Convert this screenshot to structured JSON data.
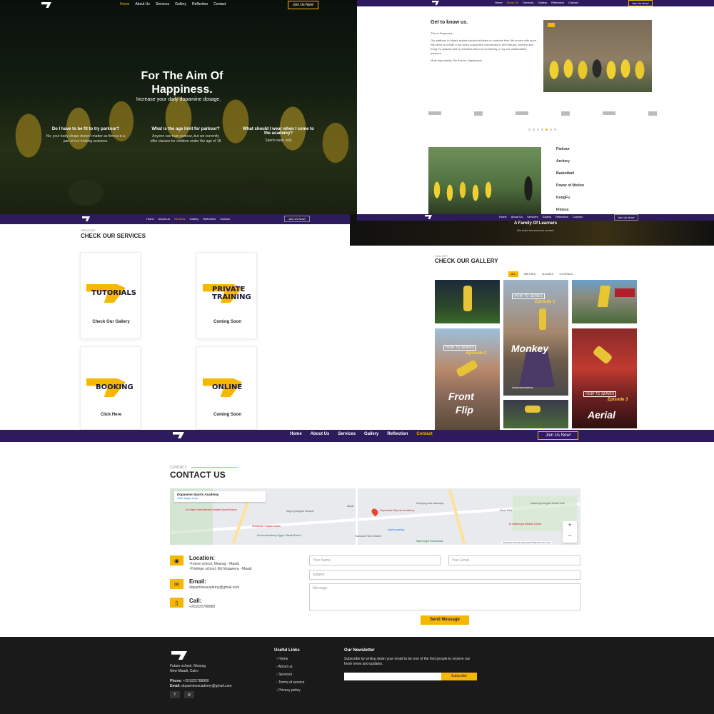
{
  "colors": {
    "primary": "#2d1b5e",
    "accent": "#f5b700",
    "dark": "#1a1a1a"
  },
  "nav": {
    "items": [
      "Home",
      "About Us",
      "Services",
      "Gallery",
      "Reflection",
      "Contact"
    ],
    "join": "Join Us Now!",
    "join_top": "Join Us Now!"
  },
  "hero": {
    "title1": "For The Aim Of",
    "title2": "Happiness.",
    "subtitle": "Increase your daily dopamine dosage.",
    "faqs": [
      {
        "q": "Do I have to be fit to try parkour?",
        "a": "No, your body shape doesn't matter as fitness is a part of our training sessions."
      },
      {
        "q": "What is the age limit for parkour?",
        "a": "Anyone can train parkour, but we currently offer classes for children under the age of 18"
      },
      {
        "q": "What should I wear when I come to the academy?",
        "a": "Sports wear only"
      }
    ]
  },
  "about": {
    "title": "Get to know us.",
    "p1": "This is Dopamine.",
    "p2": "Our platform in Maadi assists student athletes to combine their life moves with sport. We strive to create a fun and a supportive community in the Parkour, Archery and Kung Fu classes that is provided either by us directly, or by our collaborative partners.",
    "p3": "Most importantly, We Aim for Happiness!",
    "services": [
      "Parkour",
      "Archery",
      "Basketball",
      "Power of Motion",
      "KungFu",
      "Fitness"
    ]
  },
  "services_section": {
    "kicker": "SERVICES",
    "title": "CHECK OUR SERVICES",
    "cards": [
      {
        "title": "TUTORIALS",
        "action": "Check Our Gallery"
      },
      {
        "title": "PRIVATE TRAINING",
        "action": "Coming Soon"
      },
      {
        "title": "BOOKING",
        "action": "Click Here"
      },
      {
        "title": "ONLINE",
        "action": "Coming Soon"
      }
    ]
  },
  "gallery": {
    "banner_title": "A Family Of Learners",
    "banner_sub": "We build heroes from scratch",
    "kicker": "GALLERY",
    "title": "CHECK OUR GALLERY",
    "filters": [
      "ALL",
      "BBI FIELD",
      "CLASSES",
      "TUTORIALS"
    ],
    "series_tag": "HOW TO SERIES",
    "ep1": "Episode 1",
    "ep2": "Episode 2",
    "ep3": "Episode 3",
    "t_monkey": "Monkey",
    "t_front": "Front",
    "t_flip": "Flip",
    "t_aerial": "Aerial",
    "handle": "dopamineacademy"
  },
  "contact": {
    "kicker": "CONTACT",
    "title": "CONTACT US",
    "map": {
      "place": "Dopamine Sports Academy",
      "larger": "View larger map",
      "pin": "Dopamine Sports Academy",
      "footer": "Keyboard shortcuts   Map data ©2021   Terms of Use",
      "labels": [
        "As-Salam International Hospital Maadi Branch",
        "Sayyr Qurayyah Mosque",
        "Andalusia Hospital Maadi",
        "Archera Academy Egypt / Maadi Branch",
        "Aikido",
        "Shopping club katameya",
        "Stone Park",
        "Katameya Heights Health Club",
        "El Kattameya Medical Center",
        "Wadi Degla Protectorate",
        "Aspire sporting",
        "Bazooka Fried Chicken"
      ]
    },
    "location_label": "Location:",
    "location_1": "-Future school, Mearag - Maadi",
    "location_2": "-Privilege school, 6th Mujawera - Maadi",
    "email_label": "Email:",
    "email": "dopamineacademy@gmail.com",
    "call_label": "Call:",
    "phone": "+201025788880",
    "form": {
      "name": "Your Name",
      "email": "Your Email",
      "subject": "Subject",
      "message": "Message",
      "send": "Send Message"
    }
  },
  "footer": {
    "address1": "Future school, Mearag",
    "address2": "New Maadi, Cairo",
    "phone_label": "Phone:",
    "phone": "+201025788880",
    "email_label": "Email:",
    "email": "dopamineacademy@gmail.com",
    "links_title": "Useful Links",
    "links": [
      "Home",
      "About us",
      "Services",
      "Terms of service",
      "Privacy policy"
    ],
    "newsletter_title": "Our Newsletter",
    "newsletter_text": "Subscribe by writing down your email to be one of the first people to recieve our fresh news and updates.",
    "subscribe": "Subscribe"
  }
}
